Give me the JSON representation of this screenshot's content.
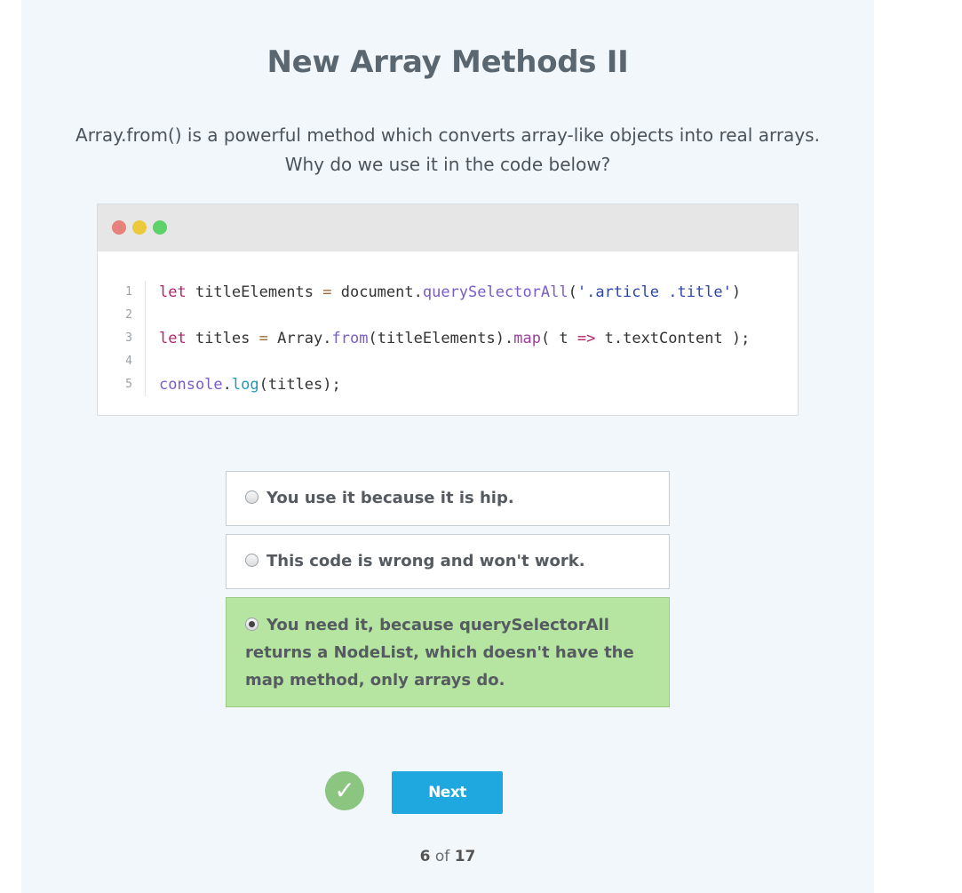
{
  "quiz": {
    "title": "New Array Methods II",
    "question_line1": "Array.from() is a powerful method which converts array-like objects into real arrays.",
    "question_line2": "Why do we use it in the code below?"
  },
  "code_window": {
    "window_buttons": [
      "close",
      "minimize",
      "maximize"
    ],
    "line_numbers": [
      "1",
      "2",
      "3",
      "4",
      "5"
    ],
    "lines": [
      "let titleElements = document.querySelectorAll('.article .title')",
      "",
      "let titles = Array.from(titleElements).map( t => t.textContent );",
      "",
      "console.log(titles);"
    ]
  },
  "options": [
    {
      "label": "You use it because it is hip.",
      "selected": false
    },
    {
      "label": "This code is wrong and won't work.",
      "selected": false
    },
    {
      "label": "You need it, because querySelectorAll returns a NodeList, which doesn't have the map method, only arrays do.",
      "selected": true
    }
  ],
  "actions": {
    "check_icon": "check-mark-icon",
    "next_label": "Next"
  },
  "progress": {
    "current": "6",
    "of_text": "of",
    "total": "17"
  },
  "colors": {
    "panel_bg": "#f2f7fb",
    "selected_option_bg": "#b6e5a2",
    "next_button": "#1fa7df",
    "check_circle": "#8bc580"
  }
}
